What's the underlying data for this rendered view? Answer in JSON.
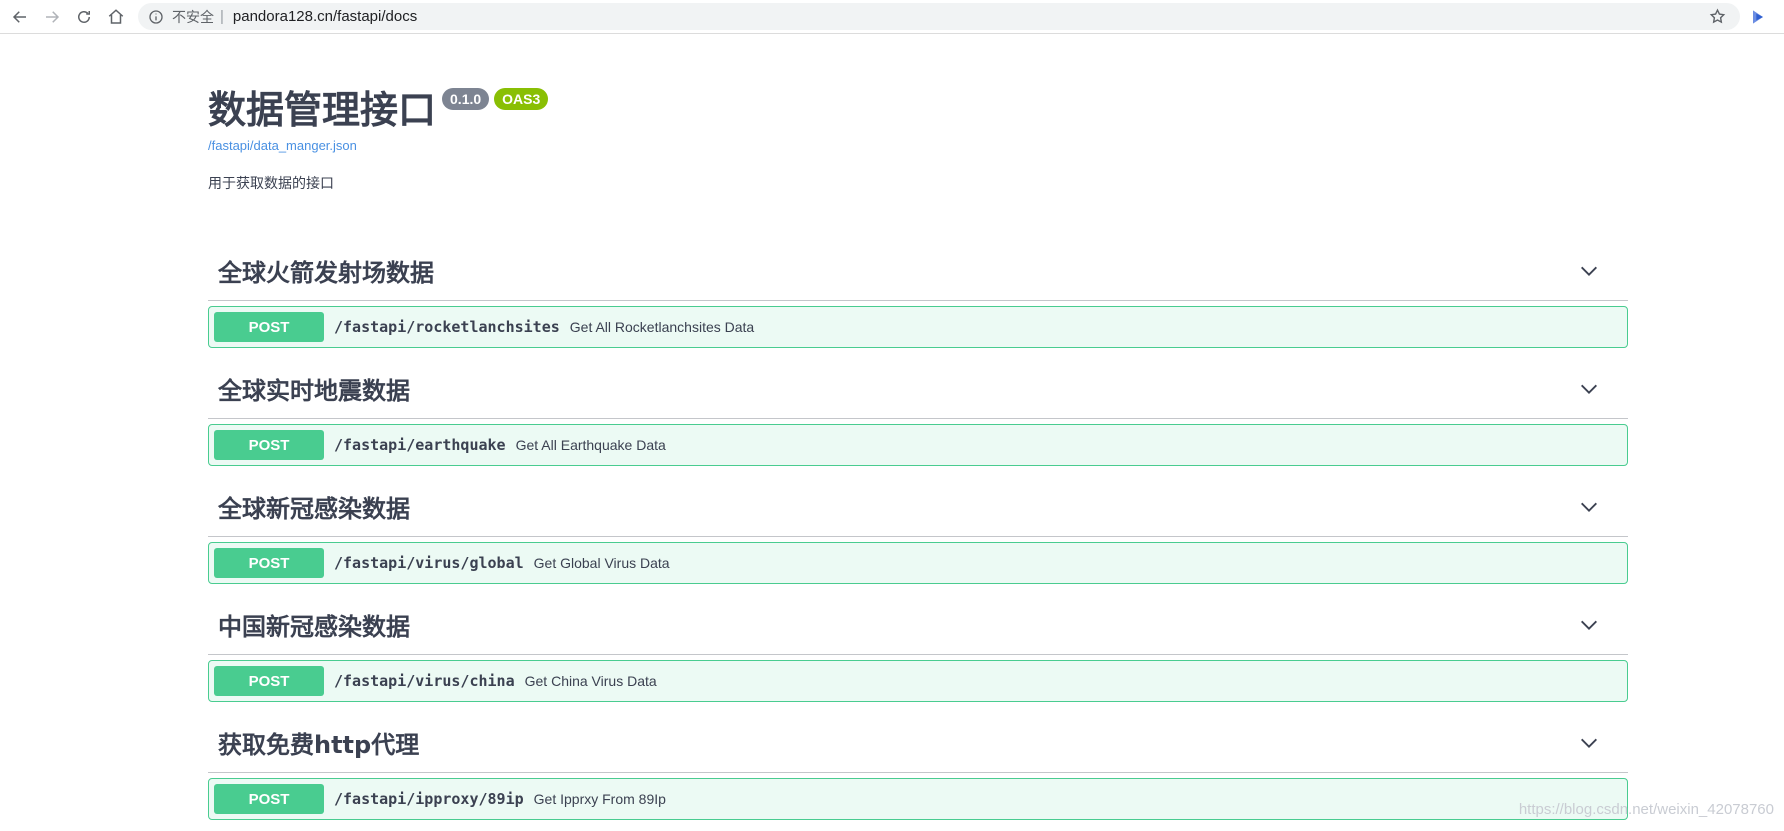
{
  "browser": {
    "security_label": "不安全",
    "url": "pandora128.cn/fastapi/docs"
  },
  "info": {
    "title": "数据管理接口",
    "version": "0.1.0",
    "oas_badge": "OAS3",
    "spec_link": "/fastapi/data_manger.json",
    "description": "用于获取数据的接口"
  },
  "tags": [
    {
      "name": "全球火箭发射场数据",
      "operation": {
        "method": "POST",
        "path": "/fastapi/rocketlanchsites",
        "summary": "Get All Rocketlanchsites Data"
      }
    },
    {
      "name": "全球实时地震数据",
      "operation": {
        "method": "POST",
        "path": "/fastapi/earthquake",
        "summary": "Get All Earthquake Data"
      }
    },
    {
      "name": "全球新冠感染数据",
      "operation": {
        "method": "POST",
        "path": "/fastapi/virus/global",
        "summary": "Get Global Virus Data"
      }
    },
    {
      "name": "中国新冠感染数据",
      "operation": {
        "method": "POST",
        "path": "/fastapi/virus/china",
        "summary": "Get China Virus Data"
      }
    },
    {
      "name": "获取免费http代理",
      "operation": {
        "method": "POST",
        "path": "/fastapi/ipproxy/89ip",
        "summary": "Get Ipprxy From 89Ip"
      }
    }
  ],
  "watermark": "https://blog.csdn.net/weixin_42078760",
  "colors": {
    "post_green": "#49cc90",
    "text_dark": "#3b4151",
    "link_blue": "#4990e2",
    "version_gray": "#7d8492",
    "oas_green": "#89bf04"
  }
}
